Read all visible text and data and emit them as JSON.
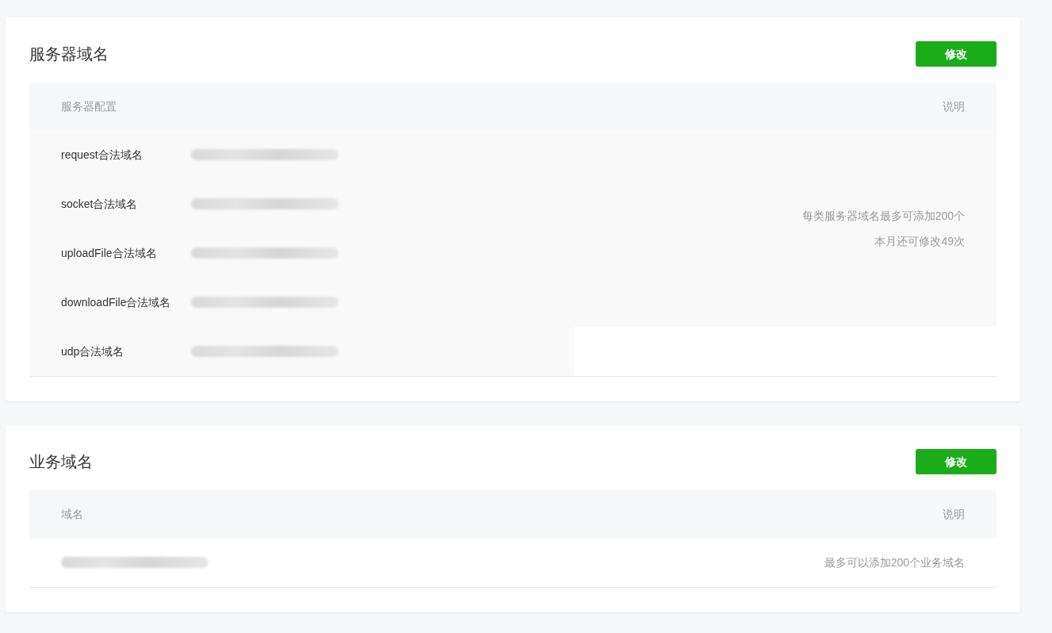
{
  "sections": [
    {
      "kind": "config-list",
      "title": "服务器域名",
      "button": "修改",
      "columns": [
        "服务器配置",
        "说明"
      ],
      "rows": [
        {
          "label": "request合法域名",
          "blurred": true
        },
        {
          "label": "socket合法域名",
          "blurred": true
        },
        {
          "label": "uploadFile合法域名",
          "blurred": true
        },
        {
          "label": "downloadFile合法域名",
          "blurred": true
        },
        {
          "label": "udp合法域名",
          "blurred": true
        }
      ],
      "notes": [
        "每类服务器域名最多可添加200个",
        "本月还可修改49次"
      ]
    },
    {
      "kind": "domain-list",
      "title": "业务域名",
      "button": "修改",
      "columns": [
        "域名",
        "说明"
      ],
      "rows": [
        {
          "blurred": true
        }
      ],
      "notes": [
        "最多可以添加200个业务域名"
      ]
    }
  ]
}
